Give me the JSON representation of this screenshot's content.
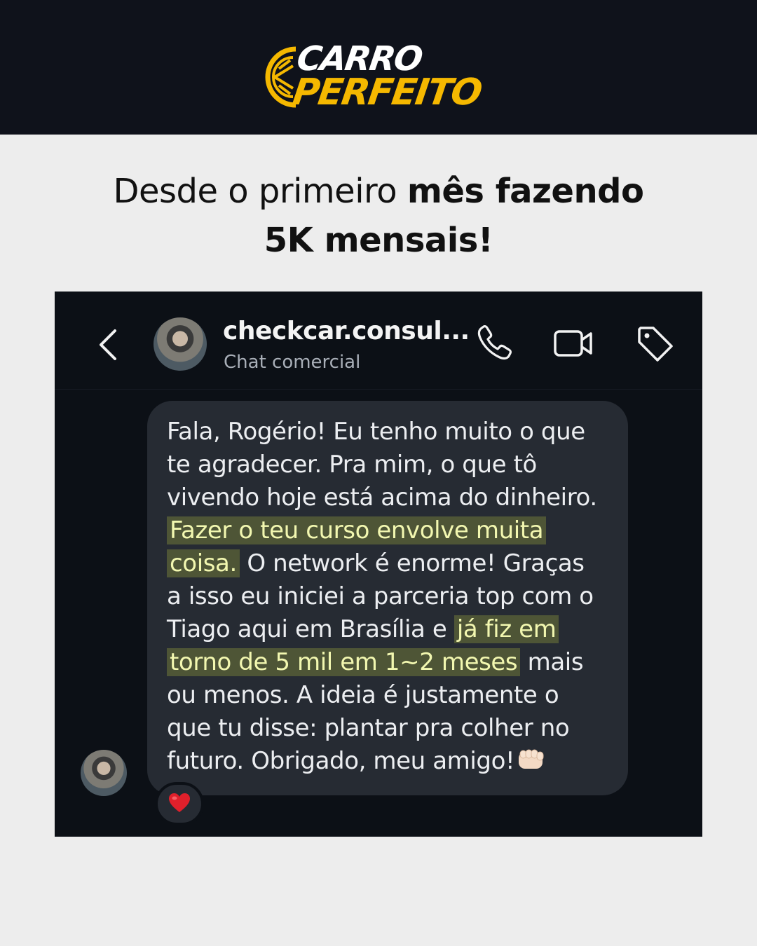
{
  "brand": {
    "logo_line_1": "CARRO",
    "logo_line_2": "PERFEITO",
    "accent_color": "#f5b800",
    "banner_color": "#0f121b"
  },
  "headline": {
    "part_1": "Desde o primeiro ",
    "part_1_bold": "mês fazendo",
    "part_2_bold": "5K mensais!"
  },
  "chat": {
    "header": {
      "back_icon": "chevron-left-icon",
      "contact_name": "checkcar.consul...",
      "subtitle": "Chat comercial",
      "actions": [
        {
          "name": "phone-icon"
        },
        {
          "name": "video-camera-icon"
        },
        {
          "name": "tag-icon"
        }
      ]
    },
    "message": {
      "lines": [
        {
          "text": "Fala, Rogério! Eu tenho muito o que"
        },
        {
          "text": "te agradecer. Pra mim, o que tô"
        },
        {
          "text": "vivendo hoje está acima do dinheiro."
        },
        {
          "hl": "Fazer o teu curso envolve muita"
        },
        {
          "hl": "coisa.",
          "after": " O network é enorme! Graças"
        },
        {
          "text": "a isso eu iniciei a parceria top com o"
        },
        {
          "text": "Tiago  aqui em Brasília e ",
          "hl": "já fiz em"
        },
        {
          "hl": "torno de 5 mil em 1~2 meses",
          "after": " mais"
        },
        {
          "text": "ou menos. A ideia é justamente o"
        },
        {
          "text": "que tu disse: plantar pra colher no"
        },
        {
          "text": "futuro. Obrigado, meu amigo!",
          "emoji": "fist-bump-emoji"
        }
      ],
      "highlight_color": "#eef27a",
      "bubble_color": "#262b33"
    },
    "reaction": {
      "emoji": "red-heart-emoji",
      "color": "#e0202b"
    }
  }
}
